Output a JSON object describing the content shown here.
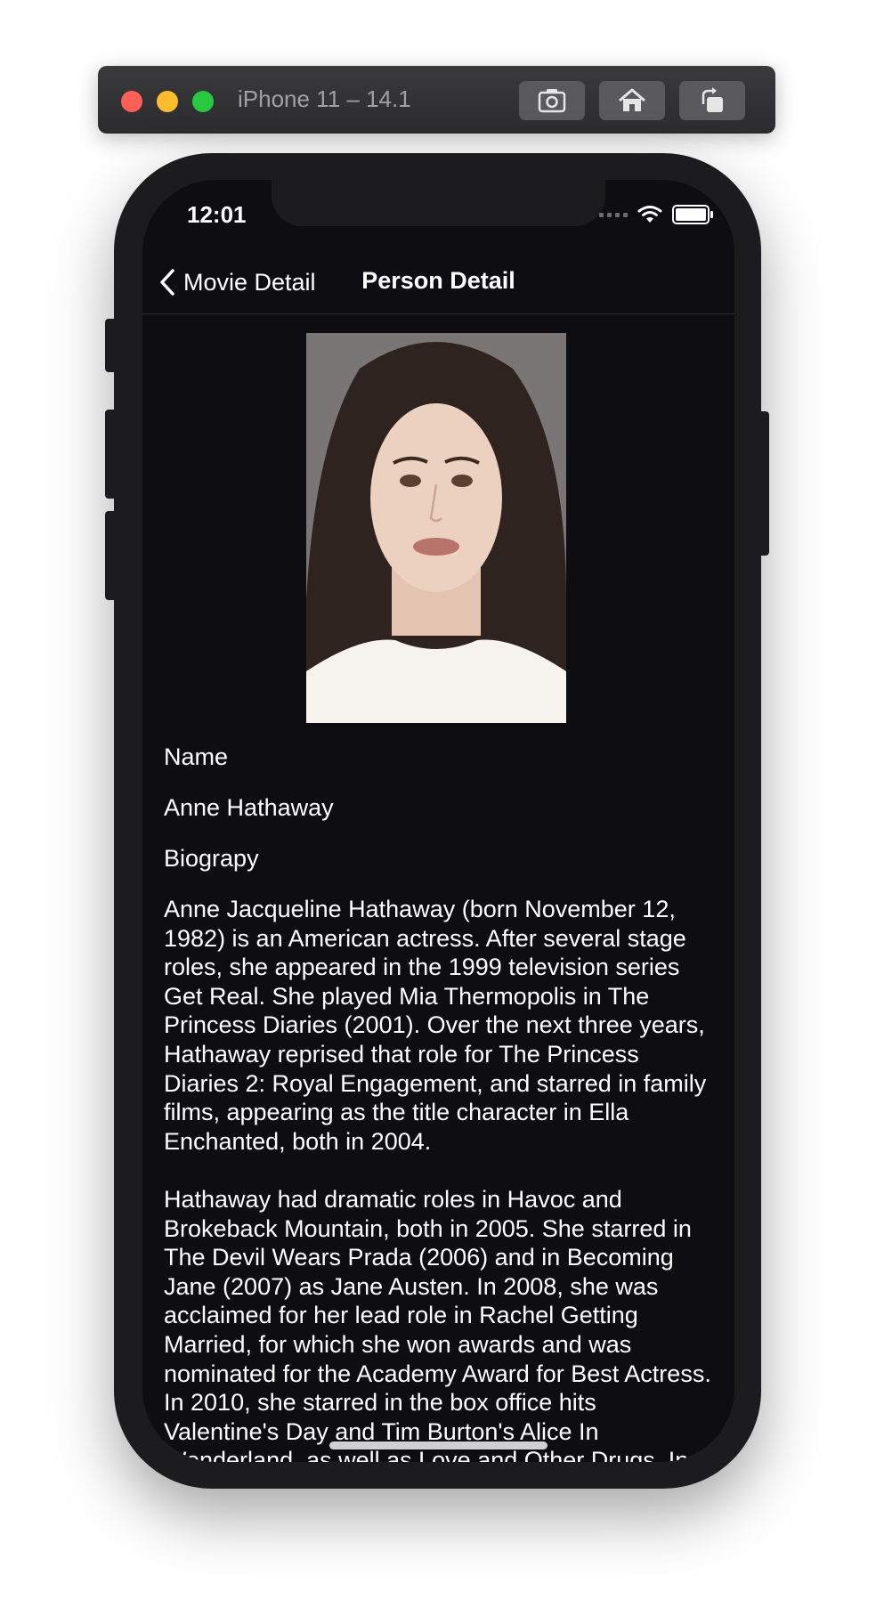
{
  "simulator": {
    "title": "iPhone 11 – 14.1",
    "buttons": [
      "screenshot-icon",
      "home-icon",
      "rotate-icon"
    ]
  },
  "status_bar": {
    "time": "12:01"
  },
  "nav": {
    "back_label": "Movie Detail",
    "title": "Person Detail"
  },
  "person": {
    "name_label": "Name",
    "name": "Anne Hathaway",
    "bio_label": "Biograpy",
    "biography": "Anne Jacqueline Hathaway (born November 12, 1982) is an American actress. After several stage roles, she appeared in the 1999 television series Get Real. She played Mia Thermopolis in The Princess Diaries (2001). Over the next three years, Hathaway reprised that role for The Princess Diaries 2: Royal Engagement, and starred in family films, appearing as the title character in Ella Enchanted, both in 2004.\n\nHathaway had dramatic roles in Havoc and Brokeback Mountain, both in 2005. She starred in The Devil Wears Prada (2006) and in Becoming Jane (2007) as Jane Austen. In 2008, she was acclaimed for her lead role in Rachel Getting Married, for which she won awards and was nominated for the Academy Award for Best Actress. In 2010, she starred in the box office hits Valentine's Day and Tim Burton's Alice In Wonderland, as well as Love and Other Drugs. In"
  },
  "colors": {
    "screen_bg": "#0e0d11",
    "text": "#ffffff",
    "device": "#1c1c1e"
  }
}
